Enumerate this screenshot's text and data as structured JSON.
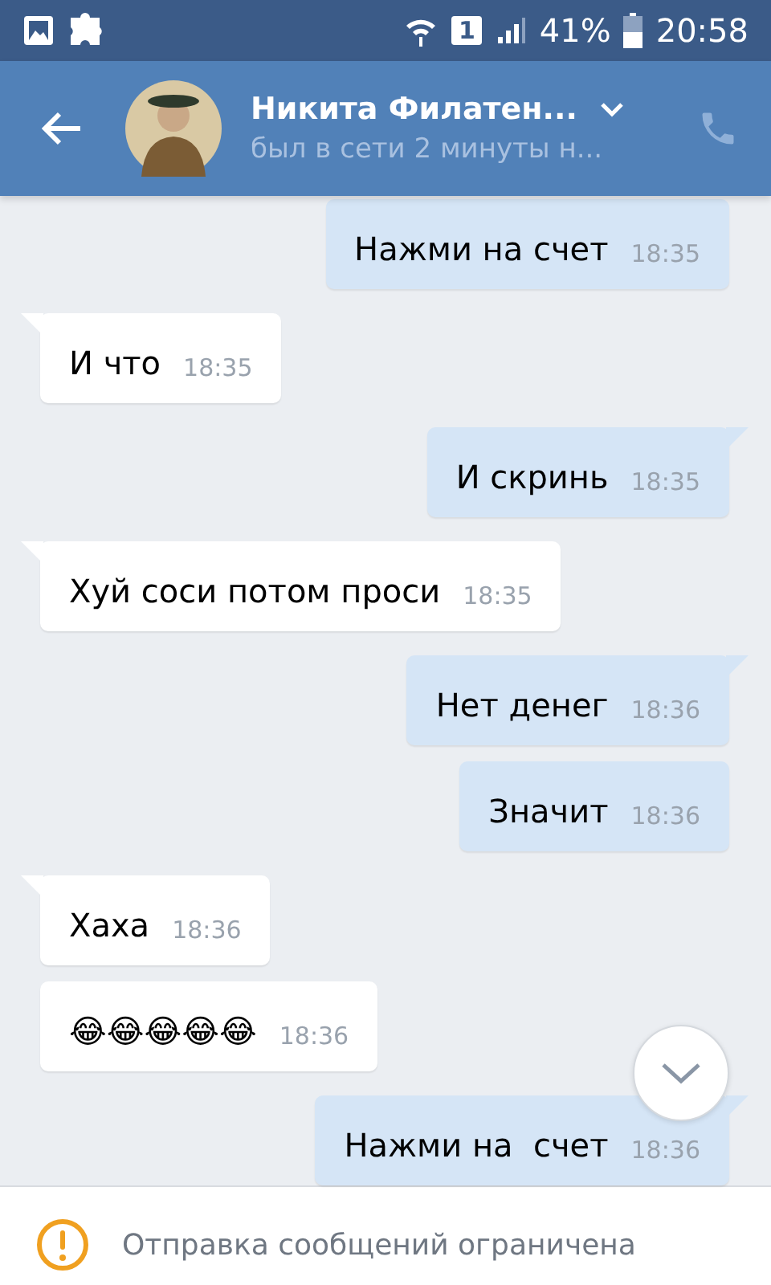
{
  "status_bar": {
    "sim": "1",
    "battery": "41%",
    "time": "20:58"
  },
  "header": {
    "name": "Никита Филатен...",
    "status": "был в сети 2 минуты н..."
  },
  "messages": [
    {
      "outgoing": true,
      "tail": false,
      "text": "Нажми на счет",
      "time": "18:35"
    },
    {
      "outgoing": false,
      "tail": true,
      "text": "И что",
      "time": "18:35"
    },
    {
      "outgoing": true,
      "tail": true,
      "text": "И скринь",
      "time": "18:35"
    },
    {
      "outgoing": false,
      "tail": true,
      "text": "Хуй соси потом проси",
      "time": "18:35"
    },
    {
      "outgoing": true,
      "tail": true,
      "text": "Нет денег",
      "time": "18:36"
    },
    {
      "outgoing": true,
      "tail": false,
      "text": "Значит",
      "time": "18:36"
    },
    {
      "outgoing": false,
      "tail": true,
      "text": "Хаха",
      "time": "18:36"
    },
    {
      "outgoing": false,
      "tail": false,
      "text": "😂😂😂😂😂",
      "time": "18:36"
    },
    {
      "outgoing": true,
      "tail": true,
      "text": "Нажми на  счет",
      "time": "18:36"
    }
  ],
  "notice": "Отправка сообщений ограничена"
}
